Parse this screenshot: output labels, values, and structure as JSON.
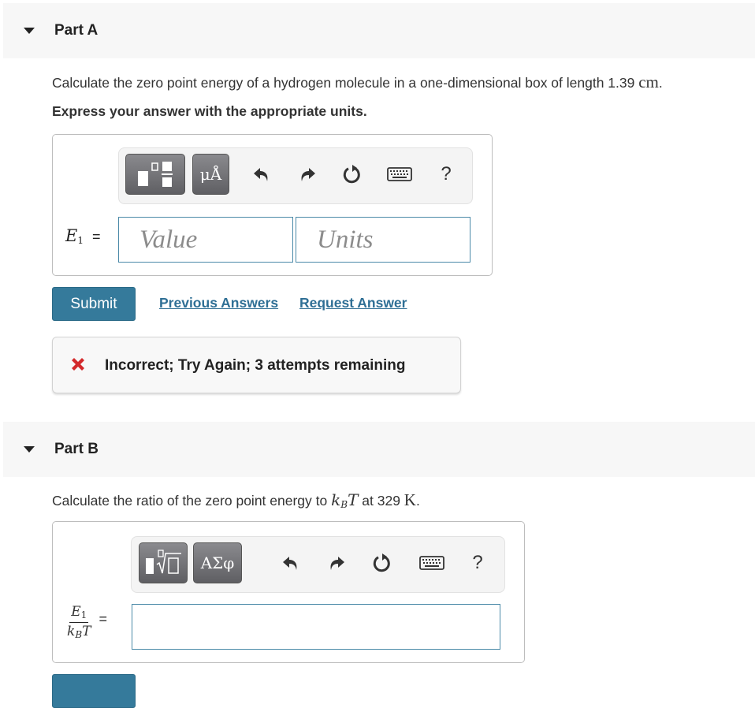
{
  "part_a": {
    "title": "Part A",
    "question_pre": "Calculate the zero point energy of a hydrogen molecule in a one-dimensional box of length 1.39 ",
    "question_unit": "cm",
    "question_post": ".",
    "instruction": "Express your answer with the appropriate units.",
    "toolbar": {
      "template_button": "templates-icon",
      "units_button_label": "μÅ",
      "undo": "undo-icon",
      "redo": "redo-icon",
      "reset": "reset-icon",
      "keyboard": "keyboard-icon",
      "help_label": "?"
    },
    "answer_label_var": "E",
    "answer_label_sub": "1",
    "answer_label_eq": "=",
    "value_placeholder": "Value",
    "units_placeholder": "Units",
    "submit_label": "Submit",
    "previous_answers_label": "Previous Answers",
    "request_answer_label": "Request Answer",
    "feedback": {
      "status": "incorrect",
      "message": "Incorrect; Try Again; 3 attempts remaining",
      "color": "#d3292b"
    }
  },
  "part_b": {
    "title": "Part B",
    "question_pre": "Calculate the ratio of the zero point energy to ",
    "question_var_k": "k",
    "question_var_sub": "B",
    "question_var_t": "T",
    "question_mid": " at 329 ",
    "question_unit": "K",
    "question_post": ".",
    "toolbar": {
      "template_button": "radical-template-icon",
      "symbols_button_label": "ΑΣφ",
      "undo": "undo-icon",
      "redo": "redo-icon",
      "reset": "reset-icon",
      "keyboard": "keyboard-icon",
      "help_label": "?"
    },
    "fraction_num_var": "E",
    "fraction_num_sub": "1",
    "fraction_den_k": "k",
    "fraction_den_sub": "B",
    "fraction_den_t": "T",
    "answer_label_eq": "=",
    "answer_value": ""
  },
  "colors": {
    "accent": "#357a9b",
    "link": "#2f6f95",
    "input_border": "#4b8aa8",
    "header_bg": "#f7f7f7"
  }
}
